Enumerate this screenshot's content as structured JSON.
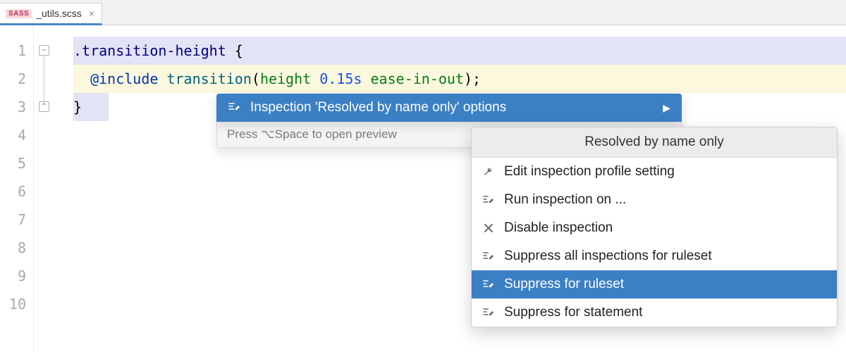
{
  "tab": {
    "badge": "SASS",
    "filename": "_utils.scss",
    "close": "×"
  },
  "gutter": {
    "lines": [
      "1",
      "2",
      "3",
      "4",
      "5",
      "6",
      "7",
      "8",
      "9",
      "10"
    ]
  },
  "code": {
    "line1": {
      "selector": ".transition-height",
      "brace": " {"
    },
    "line2": {
      "indent": "  ",
      "keyword": "@include",
      "space1": " ",
      "func": "transition",
      "open": "(",
      "prop": "height",
      "space2": " ",
      "num": "0.15s",
      "space3": " ",
      "ease": "ease-in-out",
      "close": ")",
      "semi": ";"
    },
    "line3": {
      "brace": "}"
    }
  },
  "intention": {
    "label": "Inspection 'Resolved by name only' options",
    "arrow": "▶",
    "hint": "Press ⌥Space to open preview"
  },
  "submenu": {
    "header": "Resolved by name only",
    "items": [
      {
        "icon": "wrench",
        "label": "Edit inspection profile setting"
      },
      {
        "icon": "pencil-run",
        "label": "Run inspection on ..."
      },
      {
        "icon": "cross",
        "label": "Disable inspection"
      },
      {
        "icon": "pencil-lines",
        "label": "Suppress all inspections for ruleset"
      },
      {
        "icon": "pencil-lines",
        "label": "Suppress for ruleset"
      },
      {
        "icon": "pencil-lines",
        "label": "Suppress for statement"
      }
    ]
  }
}
